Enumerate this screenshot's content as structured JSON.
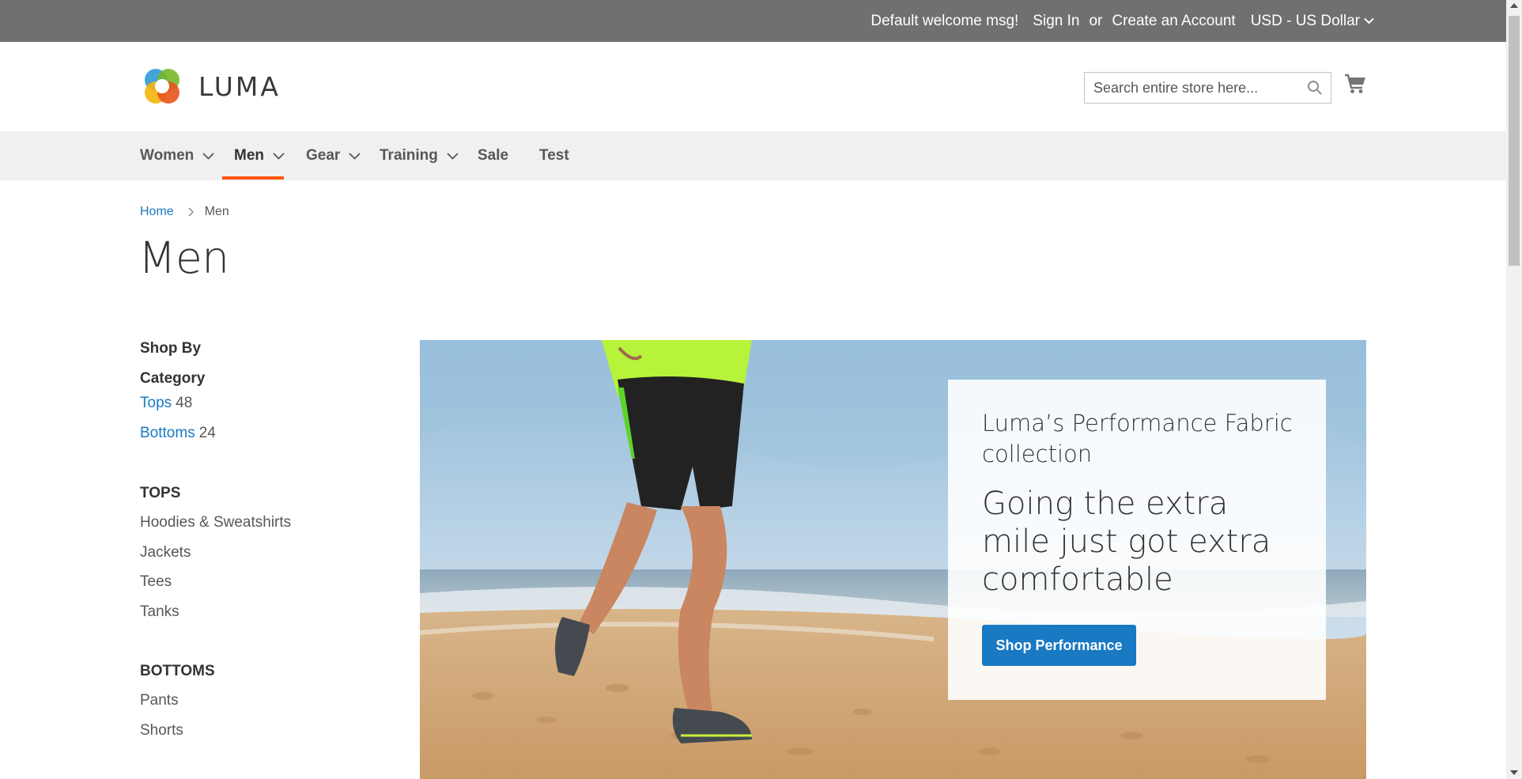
{
  "panel": {
    "welcome": "Default welcome msg!",
    "sign_in": "Sign In",
    "or": "or",
    "create_account": "Create an Account",
    "currency": "USD - US Dollar"
  },
  "header": {
    "logo_text": "LUMA",
    "search_placeholder": "Search entire store here..."
  },
  "nav": {
    "items": [
      {
        "label": "Women",
        "has_dropdown": true
      },
      {
        "label": "Men",
        "has_dropdown": true,
        "active": true
      },
      {
        "label": "Gear",
        "has_dropdown": true
      },
      {
        "label": "Training",
        "has_dropdown": true
      },
      {
        "label": "Sale",
        "has_dropdown": false
      },
      {
        "label": "Test",
        "has_dropdown": false
      }
    ]
  },
  "breadcrumb": {
    "home": "Home",
    "current": "Men"
  },
  "page_title": "Men",
  "sidebar": {
    "shop_by": "Shop By",
    "category_title": "Category",
    "categories": [
      {
        "label": "Tops",
        "count": "48"
      },
      {
        "label": "Bottoms",
        "count": "24"
      }
    ],
    "groups": [
      {
        "title": "TOPS",
        "links": [
          "Hoodies & Sweatshirts",
          "Jackets",
          "Tees",
          "Tanks"
        ]
      },
      {
        "title": "BOTTOMS",
        "links": [
          "Pants",
          "Shorts"
        ]
      }
    ]
  },
  "hero": {
    "subtitle": "Luma’s Performance Fabric collection",
    "headline": "Going the extra mile just got extra comfortable",
    "button": "Shop Performance"
  },
  "colors": {
    "panel_bg": "#6e716e",
    "nav_bg": "#f0f0f0",
    "accent_underline": "#ff5501",
    "link": "#1979c3",
    "button": "#1979c3"
  }
}
